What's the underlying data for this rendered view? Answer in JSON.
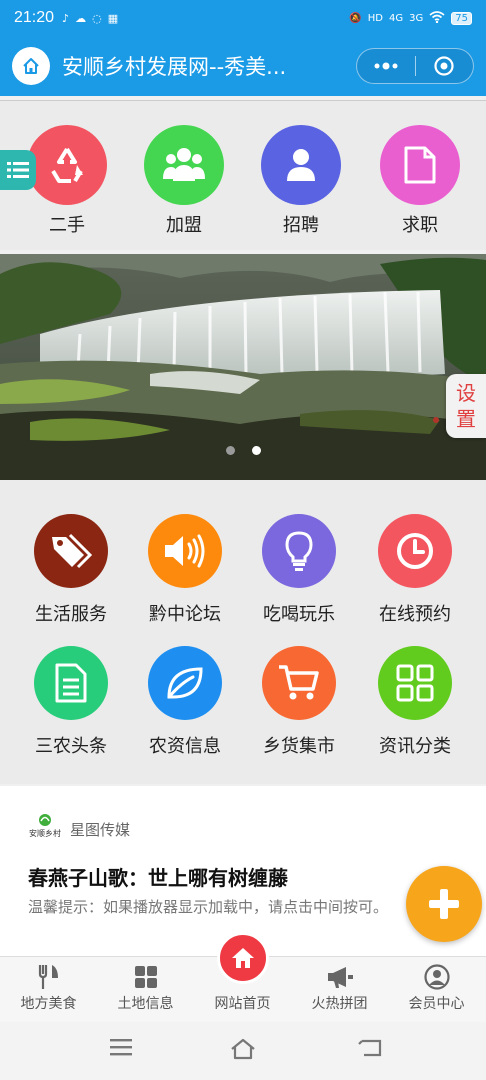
{
  "status_bar": {
    "time": "21:20",
    "network_1": "HD",
    "network_2": "4G",
    "network_3": "3G",
    "battery": "75"
  },
  "nav": {
    "title": "安顺乡村发展网--秀美...",
    "more_icon": "more-dots-icon",
    "close_icon": "target-circle-icon"
  },
  "top_icons": [
    {
      "label": "二手",
      "color": "#f25561",
      "icon": "recycle-icon"
    },
    {
      "label": "加盟",
      "color": "#44d651",
      "icon": "group-icon"
    },
    {
      "label": "招聘",
      "color": "#5a63e2",
      "icon": "person-icon"
    },
    {
      "label": "求职",
      "color": "#ea5fd0",
      "icon": "document-icon"
    }
  ],
  "side_tab": {
    "icon": "list-icon"
  },
  "banner": {
    "slides": 2,
    "active_index": 1
  },
  "settings_tab": {
    "label": "设置"
  },
  "grid": [
    {
      "label": "生活服务",
      "color": "#8a2611",
      "icon": "tags-icon"
    },
    {
      "label": "黔中论坛",
      "color": "#fd8a0d",
      "icon": "speaker-icon"
    },
    {
      "label": "吃喝玩乐",
      "color": "#7b67de",
      "icon": "lightbulb-icon"
    },
    {
      "label": "在线预约",
      "color": "#f45660",
      "icon": "clock-icon"
    },
    {
      "label": "三农头条",
      "color": "#27cd7a",
      "icon": "document-icon"
    },
    {
      "label": "农资信息",
      "color": "#1e8ff0",
      "icon": "leaf-icon"
    },
    {
      "label": "乡货集市",
      "color": "#f86832",
      "icon": "cart-icon"
    },
    {
      "label": "资讯分类",
      "color": "#61cc1e",
      "icon": "grid-icon"
    }
  ],
  "article": {
    "source_logo": "安顺乡村",
    "source": "星图传媒",
    "title": "春燕子山歌：世上哪有树缠藤",
    "desc": "温馨提示：如果播放器显示加载中，请点击中间按可。"
  },
  "fab": {
    "icon": "plus-icon",
    "color": "#f7a51a"
  },
  "tab_bar": [
    {
      "label": "地方美食",
      "icon": "utensils-icon"
    },
    {
      "label": "土地信息",
      "icon": "grid-icon"
    },
    {
      "label": "网站首页",
      "icon": "home-icon"
    },
    {
      "label": "火热拼团",
      "icon": "megaphone-icon"
    },
    {
      "label": "会员中心",
      "icon": "user-circle-icon"
    }
  ]
}
